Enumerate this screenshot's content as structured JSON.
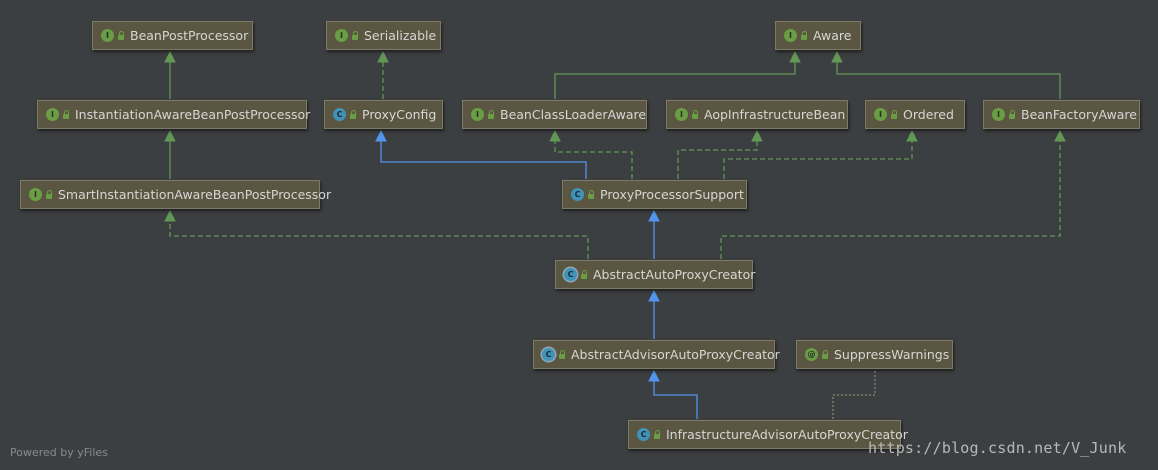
{
  "diagram": {
    "nodes": [
      {
        "id": "BeanPostProcessor",
        "label": "BeanPostProcessor",
        "kind": "interface",
        "icon": "interface-icon"
      },
      {
        "id": "Serializable",
        "label": "Serializable",
        "kind": "interface",
        "icon": "interface-icon"
      },
      {
        "id": "Aware",
        "label": "Aware",
        "kind": "interface",
        "icon": "interface-icon"
      },
      {
        "id": "InstantiationAwareBeanPostProcessor",
        "label": "InstantiationAwareBeanPostProcessor",
        "kind": "interface",
        "icon": "interface-icon"
      },
      {
        "id": "ProxyConfig",
        "label": "ProxyConfig",
        "kind": "class",
        "icon": "class-icon"
      },
      {
        "id": "BeanClassLoaderAware",
        "label": "BeanClassLoaderAware",
        "kind": "interface",
        "icon": "interface-icon"
      },
      {
        "id": "AopInfrastructureBean",
        "label": "AopInfrastructureBean",
        "kind": "interface",
        "icon": "interface-icon"
      },
      {
        "id": "Ordered",
        "label": "Ordered",
        "kind": "interface",
        "icon": "interface-icon"
      },
      {
        "id": "BeanFactoryAware",
        "label": "BeanFactoryAware",
        "kind": "interface",
        "icon": "interface-icon"
      },
      {
        "id": "SmartInstantiationAwareBeanPostProcessor",
        "label": "SmartInstantiationAwareBeanPostProcessor",
        "kind": "interface",
        "icon": "interface-icon"
      },
      {
        "id": "ProxyProcessorSupport",
        "label": "ProxyProcessorSupport",
        "kind": "class",
        "icon": "class-icon"
      },
      {
        "id": "AbstractAutoProxyCreator",
        "label": "AbstractAutoProxyCreator",
        "kind": "abstract",
        "icon": "abstract-class-icon"
      },
      {
        "id": "AbstractAdvisorAutoProxyCreator",
        "label": "AbstractAdvisorAutoProxyCreator",
        "kind": "abstract",
        "icon": "abstract-class-icon"
      },
      {
        "id": "SuppressWarnings",
        "label": "SuppressWarnings",
        "kind": "annotation",
        "icon": "annotation-icon"
      },
      {
        "id": "InfrastructureAdvisorAutoProxyCreator",
        "label": "InfrastructureAdvisorAutoProxyCreator",
        "kind": "class",
        "icon": "class-icon"
      }
    ],
    "edges": [
      {
        "from": "InstantiationAwareBeanPostProcessor",
        "to": "BeanPostProcessor",
        "type": "extends-interface"
      },
      {
        "from": "SmartInstantiationAwareBeanPostProcessor",
        "to": "InstantiationAwareBeanPostProcessor",
        "type": "extends-interface"
      },
      {
        "from": "ProxyConfig",
        "to": "Serializable",
        "type": "implements"
      },
      {
        "from": "BeanClassLoaderAware",
        "to": "Aware",
        "type": "extends-interface"
      },
      {
        "from": "BeanFactoryAware",
        "to": "Aware",
        "type": "extends-interface"
      },
      {
        "from": "ProxyProcessorSupport",
        "to": "ProxyConfig",
        "type": "extends-class"
      },
      {
        "from": "ProxyProcessorSupport",
        "to": "BeanClassLoaderAware",
        "type": "implements"
      },
      {
        "from": "ProxyProcessorSupport",
        "to": "AopInfrastructureBean",
        "type": "implements"
      },
      {
        "from": "ProxyProcessorSupport",
        "to": "Ordered",
        "type": "implements"
      },
      {
        "from": "AbstractAutoProxyCreator",
        "to": "ProxyProcessorSupport",
        "type": "extends-class"
      },
      {
        "from": "AbstractAutoProxyCreator",
        "to": "SmartInstantiationAwareBeanPostProcessor",
        "type": "implements"
      },
      {
        "from": "AbstractAutoProxyCreator",
        "to": "BeanFactoryAware",
        "type": "implements"
      },
      {
        "from": "AbstractAdvisorAutoProxyCreator",
        "to": "AbstractAutoProxyCreator",
        "type": "extends-class"
      },
      {
        "from": "InfrastructureAdvisorAutoProxyCreator",
        "to": "AbstractAdvisorAutoProxyCreator",
        "type": "extends-class"
      },
      {
        "from": "InfrastructureAdvisorAutoProxyCreator",
        "to": "SuppressWarnings",
        "type": "annotated-by"
      }
    ],
    "colors": {
      "background": "#3c3f41",
      "node_fill": "#5a5641",
      "interface_edge": "#629755",
      "class_edge": "#5394ec",
      "annotation_edge": "#8a8a6e"
    }
  },
  "badge_letters": {
    "interface": "I",
    "class": "C",
    "abstract": "C",
    "annotation": "@"
  },
  "watermarks": {
    "powered": "Powered by yFiles",
    "url": "https://blog.csdn.net/V_Junk"
  }
}
